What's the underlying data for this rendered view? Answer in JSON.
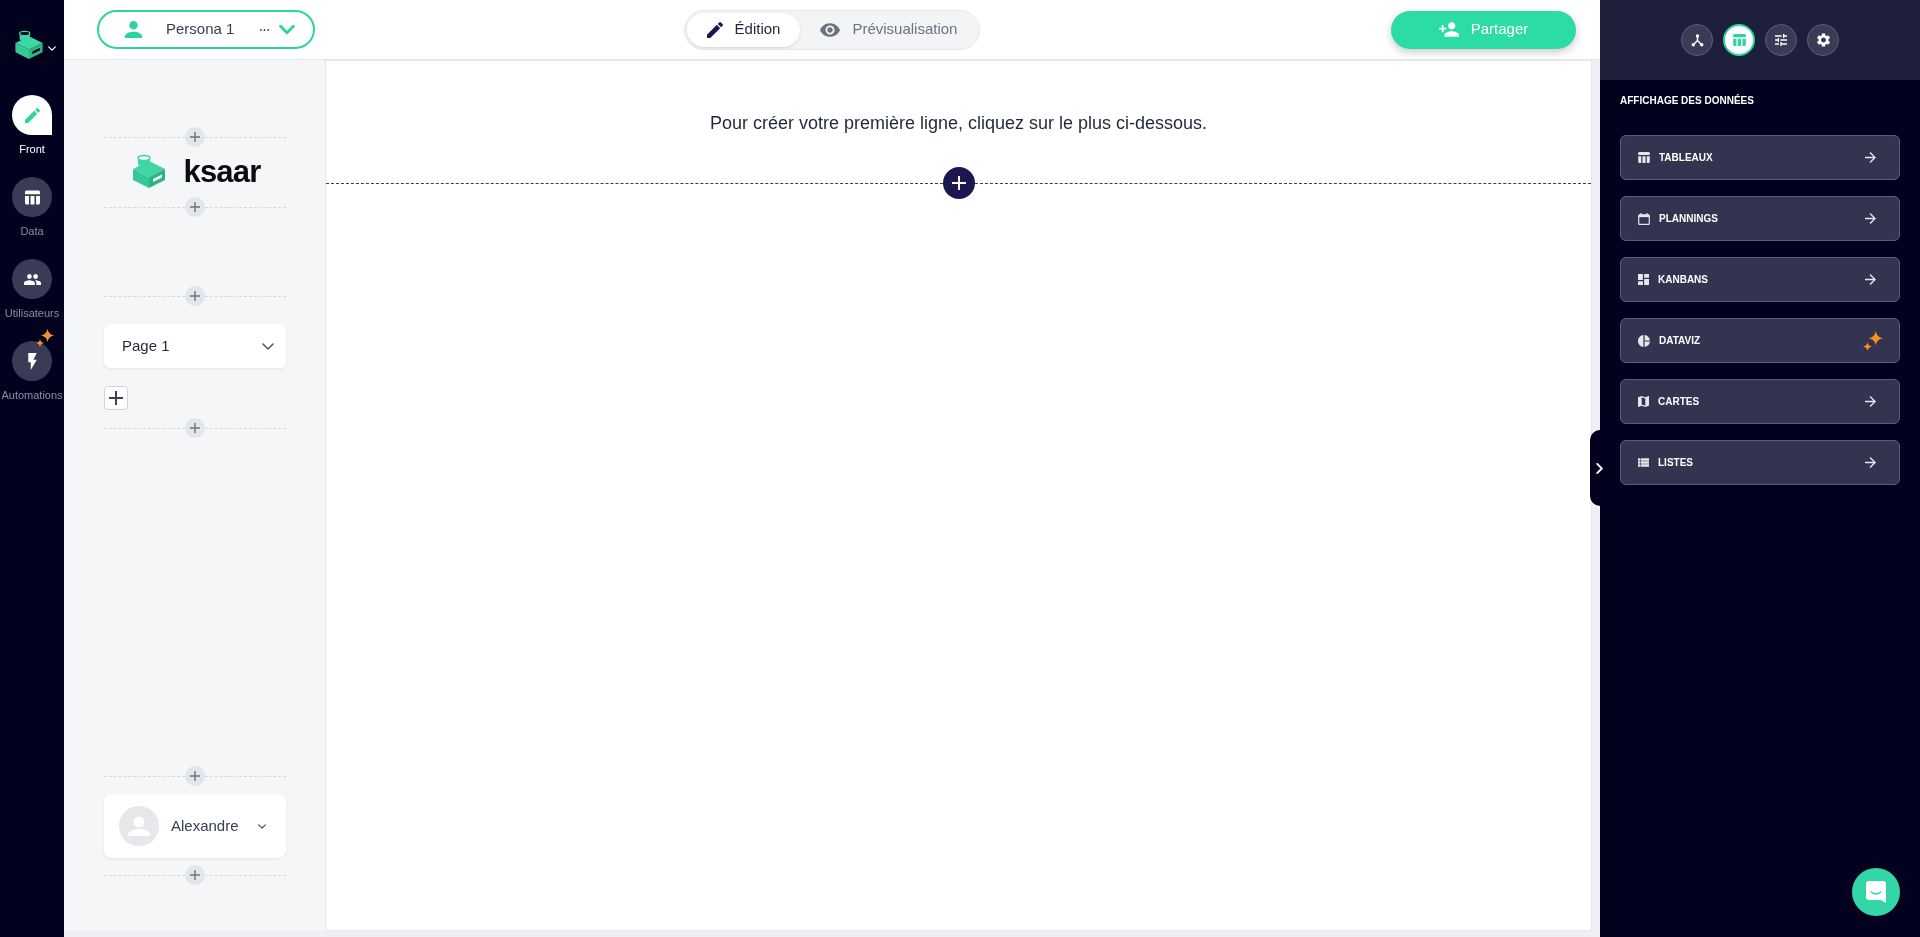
{
  "nav": {
    "items": [
      {
        "label": "Front",
        "selected": true,
        "new": false
      },
      {
        "label": "Data",
        "selected": false,
        "new": false
      },
      {
        "label": "Utilisateurs",
        "selected": false,
        "new": false
      },
      {
        "label": "Automations",
        "selected": false,
        "new": true
      }
    ]
  },
  "top_bar": {
    "persona": {
      "label": "Persona 1"
    },
    "mode_tabs": [
      {
        "label": "Édition",
        "selected": true
      },
      {
        "label": "Prévisualisation",
        "selected": false
      }
    ],
    "share_button": {
      "label": "Partager"
    }
  },
  "left_panel": {
    "logo": {
      "text": "ksaar"
    },
    "page_select": {
      "value": "Page 1"
    },
    "user_menu": {
      "name": "Alexandre"
    }
  },
  "canvas": {
    "hint": "Pour créer votre première ligne, cliquez sur le plus ci-dessous."
  },
  "right_panel": {
    "tabs": [
      {
        "selected": false
      },
      {
        "selected": true
      },
      {
        "selected": false
      },
      {
        "selected": false
      }
    ],
    "section_title": "AFFICHAGE DES DONNÉES",
    "items": [
      {
        "label": "TABLEAUX",
        "new": false
      },
      {
        "label": "PLANNINGS",
        "new": false
      },
      {
        "label": "KANBANS",
        "new": false
      },
      {
        "label": "DATAVIZ",
        "new": true
      },
      {
        "label": "CARTES",
        "new": false
      },
      {
        "label": "LISTES",
        "new": false
      }
    ]
  }
}
